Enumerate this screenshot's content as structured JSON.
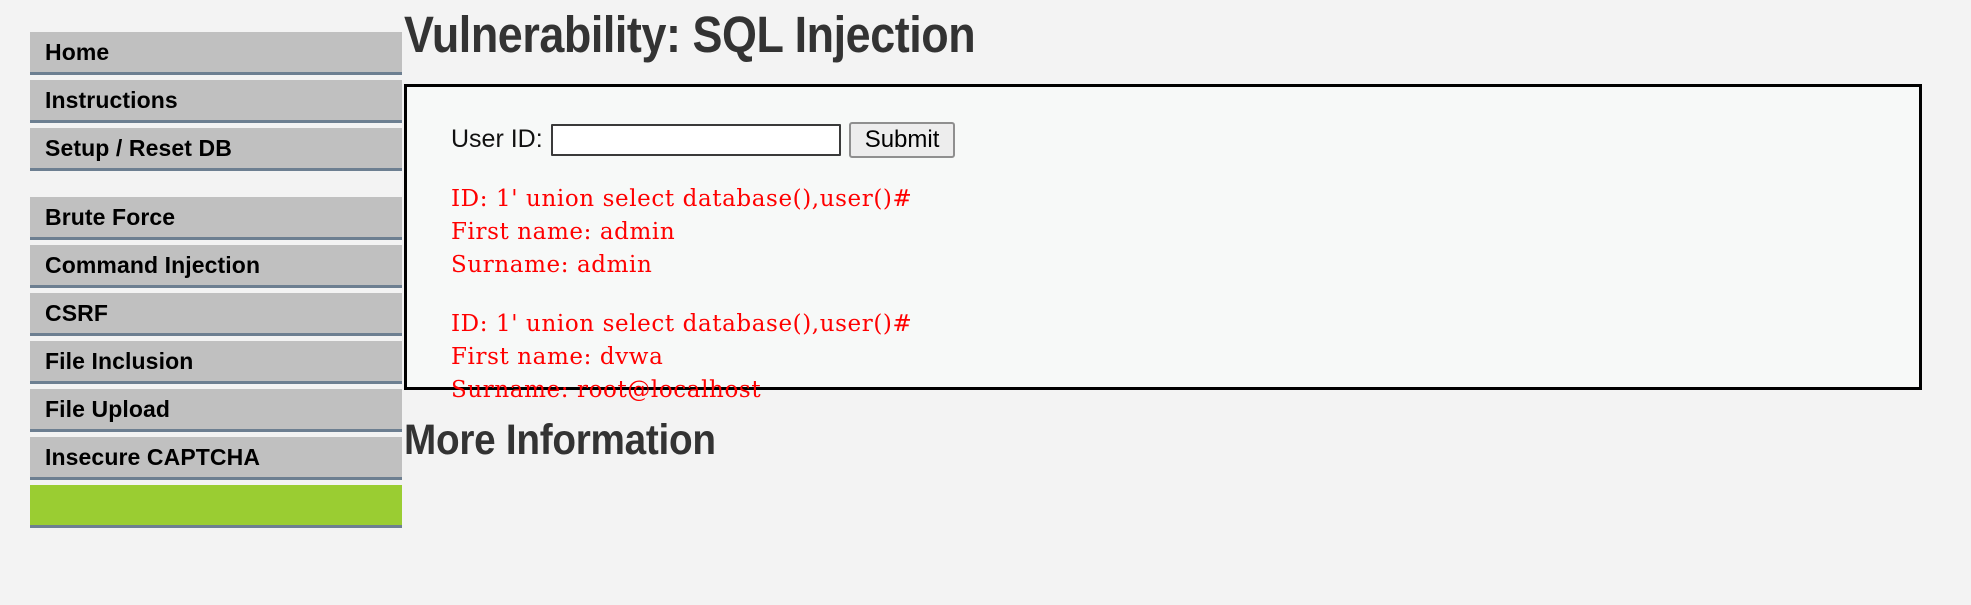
{
  "app": {
    "name": "DVWA",
    "colors": {
      "page_background": "#f3f3f3",
      "nav_button": "#c0c0c0",
      "nav_button_border": "#6d7f91",
      "nav_active": "#9acd32",
      "heading_text": "#333333",
      "result_text": "#ff0000",
      "box_border": "#000000",
      "box_background": "#f7f9f8"
    }
  },
  "sidebar": {
    "groups": [
      {
        "items": [
          {
            "label": "Home",
            "active": false
          },
          {
            "label": "Instructions",
            "active": false
          },
          {
            "label": "Setup / Reset DB",
            "active": false
          }
        ]
      },
      {
        "items": [
          {
            "label": "Brute Force",
            "active": false
          },
          {
            "label": "Command Injection",
            "active": false
          },
          {
            "label": "CSRF",
            "active": false
          },
          {
            "label": "File Inclusion",
            "active": false
          },
          {
            "label": "File Upload",
            "active": false
          },
          {
            "label": "Insecure CAPTCHA",
            "active": false
          },
          {
            "label": "",
            "active": true
          }
        ]
      }
    ]
  },
  "main": {
    "page_title": "Vulnerability: SQL Injection",
    "form": {
      "label": "User ID:",
      "input_value": "",
      "input_placeholder": "",
      "submit_label": "Submit"
    },
    "results": [
      {
        "lines": [
          "ID: 1' union select database(),user()#",
          "First name: admin",
          "Surname: admin"
        ]
      },
      {
        "lines": [
          "ID: 1' union select database(),user()#",
          "First name: dvwa",
          "Surname: root@localhost"
        ]
      }
    ],
    "more_information_title": "More Information"
  }
}
